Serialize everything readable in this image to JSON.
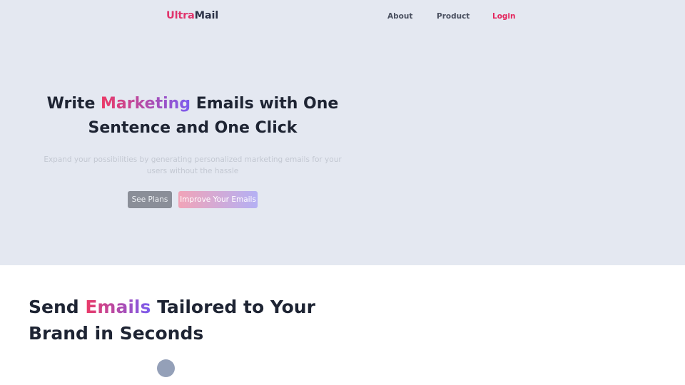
{
  "header": {
    "logo_part1": "Ultra",
    "logo_part2": "Mail",
    "nav": {
      "about": "About",
      "product": "Product",
      "login": "Login"
    }
  },
  "hero": {
    "title_pre": "Write ",
    "title_highlight": "Marketing",
    "title_post": " Emails with One Sentence and One Click",
    "subtitle": "Expand your possibilities by generating personalized marketing emails for your users without the hassle",
    "buttons": {
      "see_plans": "See Plans",
      "improve": "Improve Your Emails"
    }
  },
  "section": {
    "title_pre": "Send ",
    "title_highlight": "Emails",
    "title_post": " Tailored to Your Brand in Seconds"
  },
  "colors": {
    "accent_pink": "#e3245c",
    "accent_purple": "#7a5cf0",
    "hero_bg": "#e4e8f1",
    "dot": "#94a0b8"
  }
}
